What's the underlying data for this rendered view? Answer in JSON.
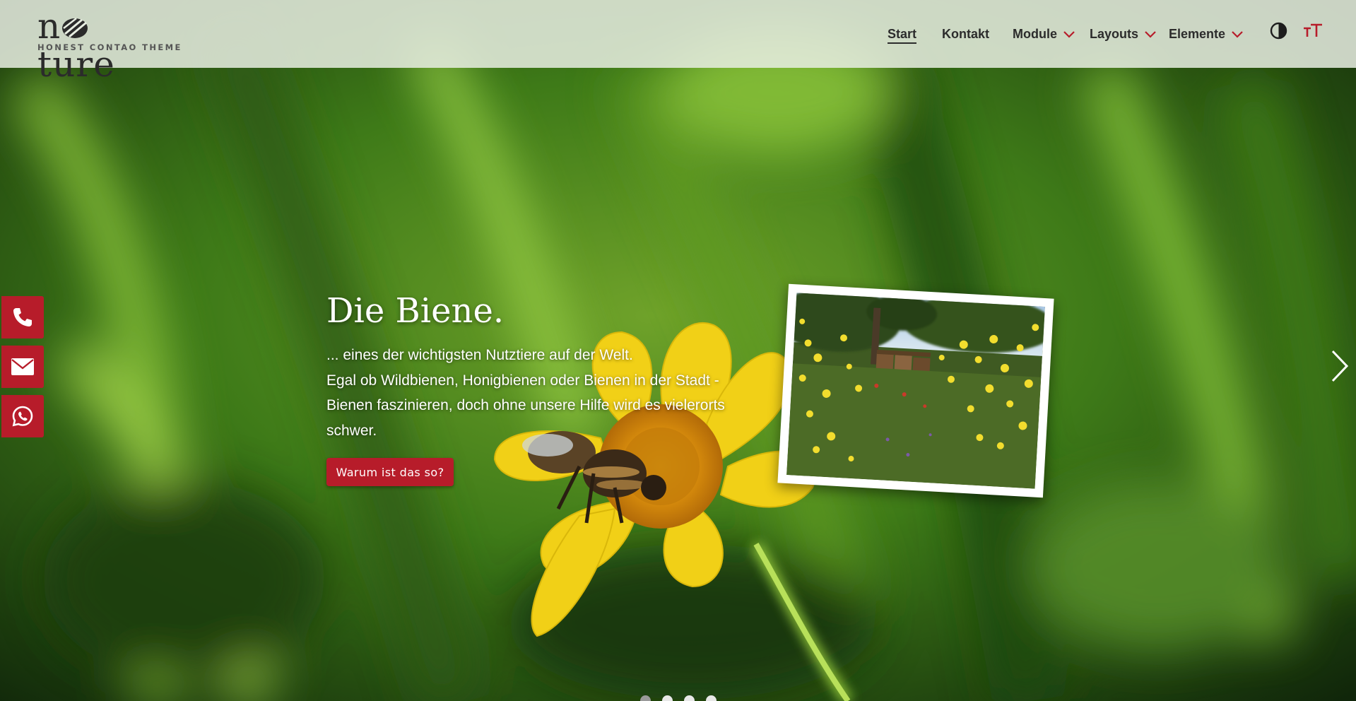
{
  "header": {
    "logo_word_start": "n",
    "logo_word_end": "ture",
    "logo_tagline": "HONEST CONTAO THEME"
  },
  "nav": {
    "items": [
      {
        "label": "Start",
        "active": true,
        "has_dropdown": false
      },
      {
        "label": "Kontakt",
        "active": false,
        "has_dropdown": false
      },
      {
        "label": "Module",
        "active": false,
        "has_dropdown": true
      },
      {
        "label": "Layouts",
        "active": false,
        "has_dropdown": true
      },
      {
        "label": "Elemente",
        "active": false,
        "has_dropdown": true
      }
    ],
    "contrast_icon": "contrast-toggle-icon",
    "font_size_icon": "font-size-icon"
  },
  "side_contacts": [
    {
      "icon": "phone-icon"
    },
    {
      "icon": "mail-icon"
    },
    {
      "icon": "whatsapp-icon"
    }
  ],
  "slide": {
    "title": "Die Biene.",
    "lines": [
      "... eines der wichtigsten Nutztiere auf der Welt.",
      "Egal ob Wildbienen, Honigbienen oder Bienen in der Stadt -",
      "Bienen faszinieren, doch ohne unsere Hilfe wird es vielerorts",
      "schwer."
    ],
    "cta_label": "Warum ist das so?",
    "next_icon": "chevron-right-icon"
  },
  "slider": {
    "slide_count": 4,
    "active_index": 0
  },
  "colors": {
    "accent": "#b71c2a",
    "header_bg": "#e8eee2",
    "nav_text": "#2c2c2c",
    "white": "#ffffff"
  }
}
